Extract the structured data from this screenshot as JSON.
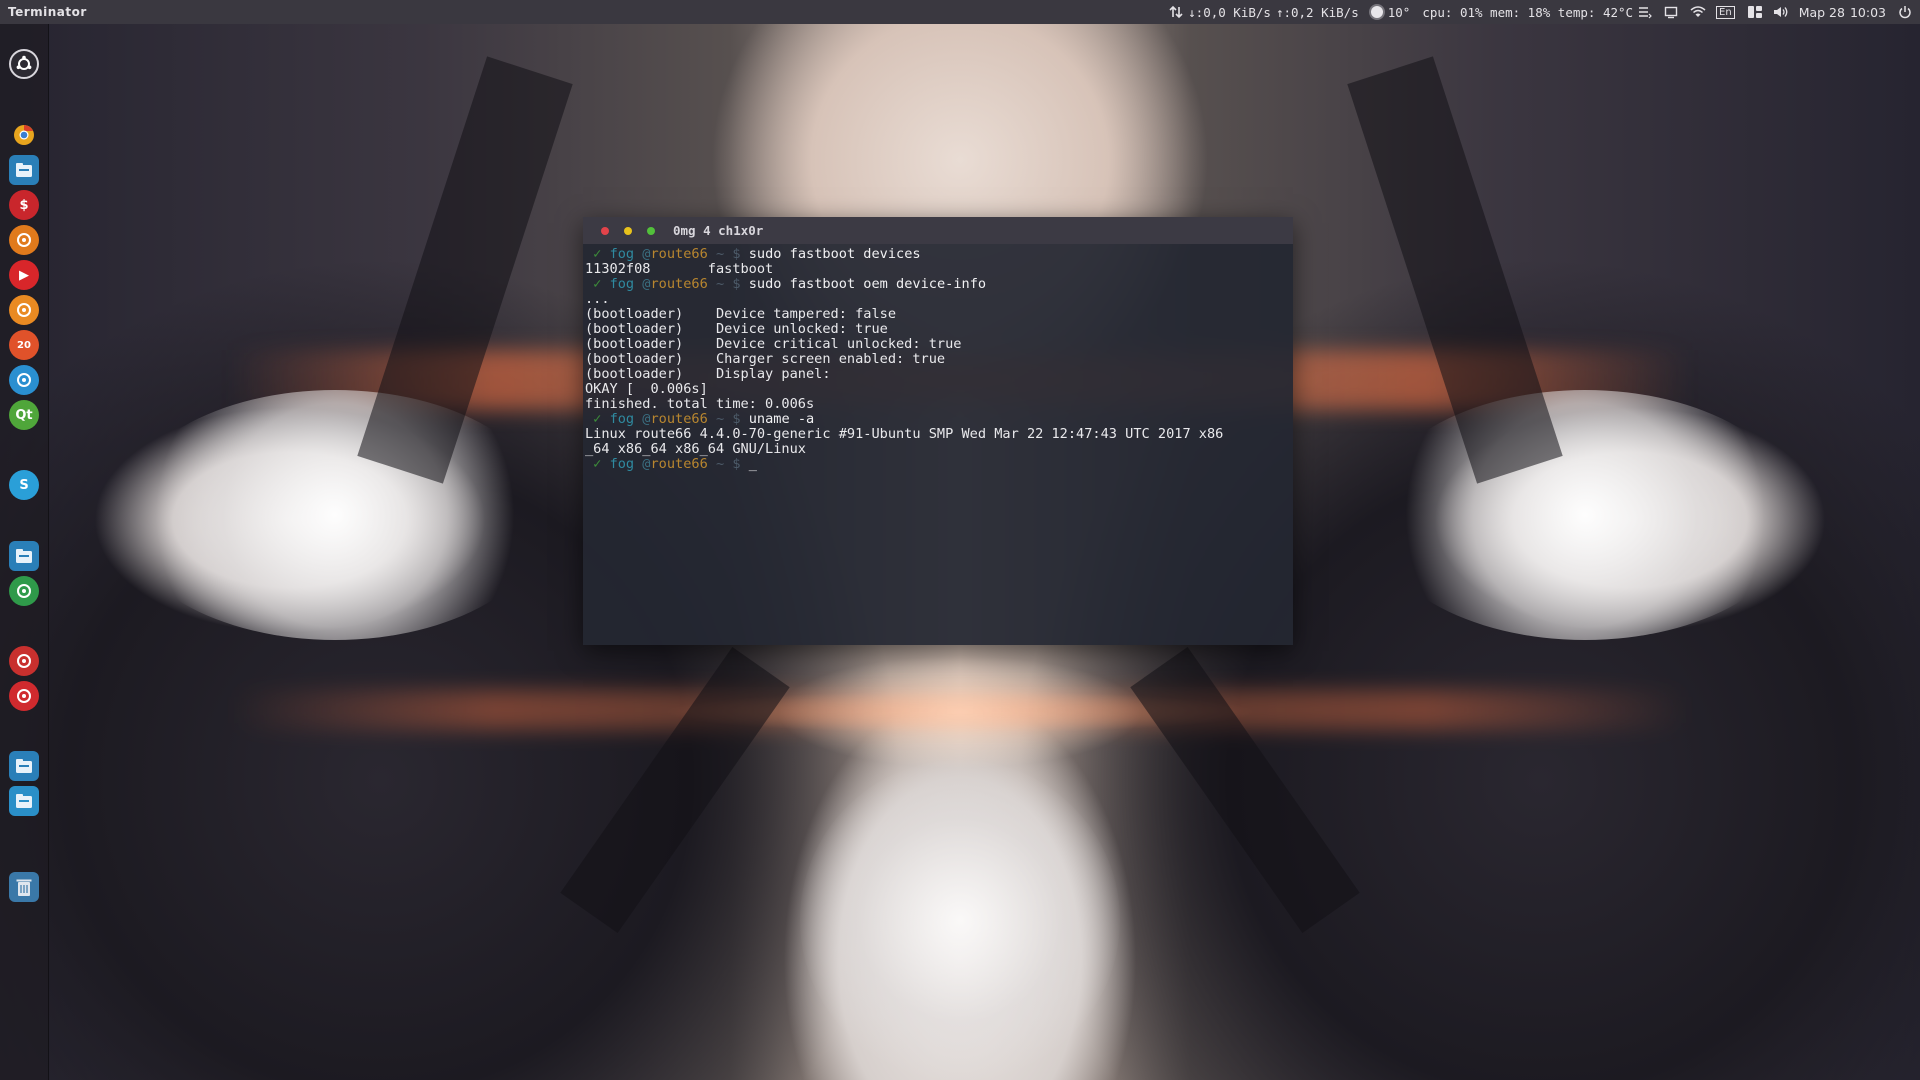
{
  "panel": {
    "app_title": "Terminator",
    "network_down": "↓:0,0 KiB/s",
    "network_up": "↑:0,2 KiB/s",
    "weather": "10°",
    "sysmon": "cpu: 01% mem: 18% temp: 42°C",
    "keyboard_layout": "En",
    "date": "Мар 28",
    "time": "10:03"
  },
  "launcher": {
    "items": [
      {
        "name": "ubuntu-dash-icon",
        "glyph": "",
        "color": "#2c2a32"
      },
      {
        "name": "chrome-icon",
        "glyph": "",
        "color": "#e0642a"
      },
      {
        "name": "files-icon",
        "glyph": "",
        "color": "#2a7fb8"
      },
      {
        "name": "money-icon",
        "glyph": "$",
        "color": "#c9262c"
      },
      {
        "name": "app-orange-icon",
        "glyph": "",
        "color": "#e07a1c"
      },
      {
        "name": "youtube-icon",
        "glyph": "▶",
        "color": "#d8262a"
      },
      {
        "name": "orange-wheel-icon",
        "glyph": "",
        "color": "#e98a22"
      },
      {
        "name": "game-2048-icon",
        "glyph": "20",
        "color": "#e0522a"
      },
      {
        "name": "refresh-app-icon",
        "glyph": "",
        "color": "#2a8fd0"
      },
      {
        "name": "qt-creator-icon",
        "glyph": "Qt",
        "color": "#4fa63a"
      },
      {
        "name": "skype-icon",
        "glyph": "S",
        "color": "#2a9fd8"
      },
      {
        "name": "files-2-icon",
        "glyph": "",
        "color": "#2a7fb8"
      },
      {
        "name": "app-green-icon",
        "glyph": "",
        "color": "#2f9a4a"
      },
      {
        "name": "toggle-app-icon",
        "glyph": "",
        "color": "#c8302e"
      },
      {
        "name": "media-app-icon",
        "glyph": "",
        "color": "#d02a2e"
      },
      {
        "name": "workspace-switcher-icon",
        "glyph": "",
        "color": "#2a7fb8"
      },
      {
        "name": "disk-app-icon",
        "glyph": "",
        "color": "#2a8fc8"
      },
      {
        "name": "trash-icon",
        "glyph": "",
        "color": "#3a78a8"
      }
    ]
  },
  "terminal": {
    "title": "0mg 4 ch1x0r",
    "prompt": {
      "check": "✓",
      "user": "fog",
      "at": "@",
      "host": "route66",
      "dir": "~",
      "symbol": "$"
    },
    "lines": [
      {
        "type": "prompt",
        "cmd": "sudo fastboot devices"
      },
      {
        "type": "out",
        "text": "11302f08       fastboot"
      },
      {
        "type": "prompt",
        "cmd": "sudo fastboot oem device-info"
      },
      {
        "type": "out",
        "text": "..."
      },
      {
        "type": "out",
        "text": "(bootloader)    Device tampered: false"
      },
      {
        "type": "out",
        "text": "(bootloader)    Device unlocked: true"
      },
      {
        "type": "out",
        "text": "(bootloader)    Device critical unlocked: true"
      },
      {
        "type": "out",
        "text": "(bootloader)    Charger screen enabled: true"
      },
      {
        "type": "out",
        "text": "(bootloader)    Display panel:"
      },
      {
        "type": "out",
        "text": "OKAY [  0.006s]"
      },
      {
        "type": "out",
        "text": "finished. total time: 0.006s"
      },
      {
        "type": "prompt",
        "cmd": "uname -a"
      },
      {
        "type": "out",
        "text": "Linux route66 4.4.0-70-generic #91-Ubuntu SMP Wed Mar 22 12:47:43 UTC 2017 x86"
      },
      {
        "type": "out",
        "text": "_64 x86_64 x86_64 GNU/Linux"
      },
      {
        "type": "prompt",
        "cmd": "_"
      }
    ]
  }
}
